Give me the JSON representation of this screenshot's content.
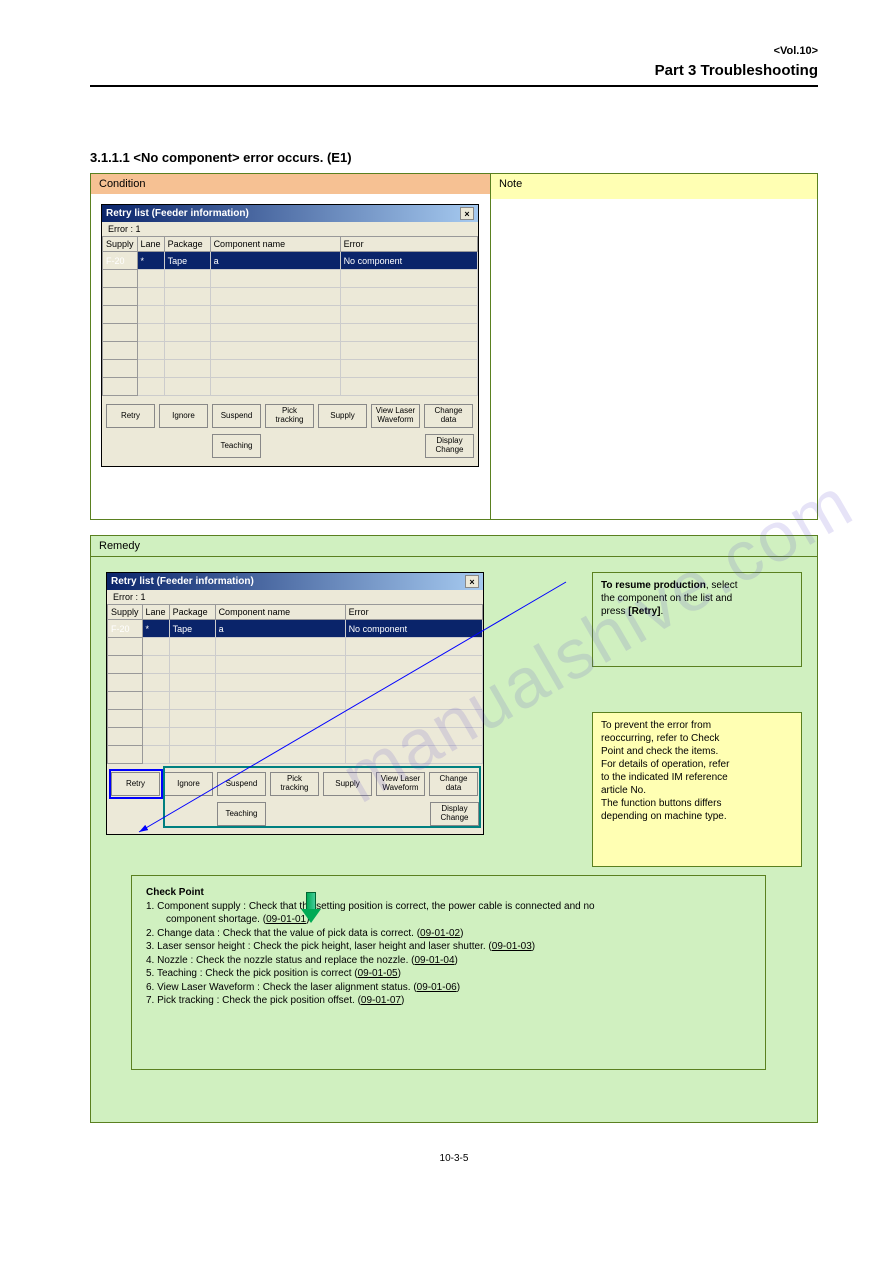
{
  "header": {
    "volume": "<Vol.10>",
    "title": "Part 3 Troubleshooting",
    "heading": "3.1.1.1 <No component> error occurs. (E1)"
  },
  "panel_top": {
    "left_header": "Condition",
    "right_header": "Note"
  },
  "dialog": {
    "title": "Retry list (Feeder information)",
    "close": "×",
    "error_label": "Error : 1",
    "headers": {
      "supply": "Supply",
      "lane": "Lane",
      "package": "Package",
      "component": "Component name",
      "error": "Error"
    },
    "row": {
      "supply": "F-20",
      "lane": "*",
      "package": "Tape",
      "component": "a",
      "error": "No component"
    },
    "buttons": {
      "retry": "Retry",
      "ignore": "Ignore",
      "suspend": "Suspend",
      "pick": "Pick tracking",
      "supply": "Supply",
      "laser": "View Laser Waveform",
      "change": "Change data",
      "teaching": "Teaching",
      "display": "Display Change"
    }
  },
  "panel_bottom": {
    "header": "Remedy"
  },
  "callout1": {
    "line1_bold": "To resume production",
    "line1_rest": ", select",
    "line2": "the component on the list and",
    "line3a": "press ",
    "line3b": "[Retry]",
    "line3c": "."
  },
  "callout2": {
    "l1": "To prevent the error from",
    "l2": "reoccurring, refer to Check",
    "l3": "Point and check the items.",
    "l4": "For details of operation, refer",
    "l5": "to the indicated IM reference",
    "l6": "article No.",
    "l7": "The function buttons differs",
    "l8": "depending on machine type."
  },
  "callout3": {
    "h": "Check Point",
    "r1a": "1. Component supply : Check that the setting position is correct, the power cable is connected and no",
    "r1b": "component shortage. (",
    "r1c": "09-01-01",
    "r1d": ")",
    "r2a": "2. Change data : Check that the value of pick data is correct. (",
    "r2b": "09-01-02",
    "r2c": ")",
    "r3a": "3. Laser sensor height : Check the pick height, laser height and laser shutter. (",
    "r3b": "09-01-03",
    "r3c": ")",
    "r4a": "4. Nozzle : Check the nozzle status and replace the nozzle. (",
    "r4b": "09-01-04",
    "r4c": ")",
    "r5a": "5. Teaching : Check the pick position is correct (",
    "r5b": "09-01-05",
    "r5c": ")",
    "r6a": "6. View Laser Waveform : Check the laser alignment status. (",
    "r6b": "09-01-06",
    "r6c": ")",
    "r7a": "7. Pick tracking : Check the pick position offset. (",
    "r7b": "09-01-07",
    "r7c": ")"
  },
  "footer": "10-3-5"
}
